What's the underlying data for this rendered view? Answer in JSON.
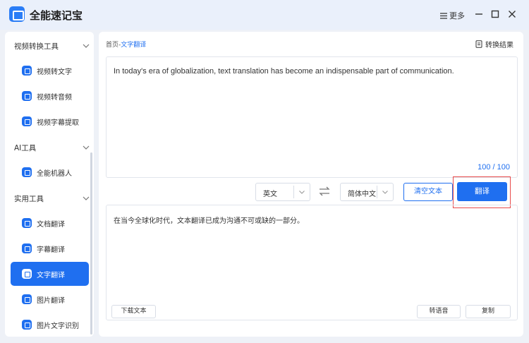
{
  "app": {
    "title": "全能速记宝",
    "more_label": "更多"
  },
  "sidebar": {
    "groups": [
      {
        "label": "视频转换工具",
        "items": [
          {
            "label": "视频转文字"
          },
          {
            "label": "视频转音频"
          },
          {
            "label": "视频字幕提取"
          }
        ]
      },
      {
        "label": "AI工具",
        "items": [
          {
            "label": "全能机器人"
          }
        ]
      },
      {
        "label": "实用工具",
        "items": [
          {
            "label": "文档翻译"
          },
          {
            "label": "字幕翻译"
          },
          {
            "label": "文字翻译",
            "active": true
          },
          {
            "label": "图片翻译"
          },
          {
            "label": "图片文字识别"
          }
        ]
      }
    ]
  },
  "main": {
    "breadcrumb": {
      "home": "首页",
      "sep": "-",
      "current": "文字翻译"
    },
    "result_link": "转换结果",
    "input_text": "In today's era of globalization, text translation has become an indispensable part of communication.",
    "counter": "100 / 100",
    "source_lang": "英文",
    "target_lang": "简体中文",
    "clear_label": "清空文本",
    "translate_label": "翻译",
    "output_text": "在当今全球化时代，文本翻译已成为沟通不可或缺的一部分。",
    "download_label": "下载文本",
    "tts_label": "转语音",
    "copy_label": "复制"
  },
  "colors": {
    "accent": "#1f6ff0",
    "highlight": "#e84b4b"
  }
}
